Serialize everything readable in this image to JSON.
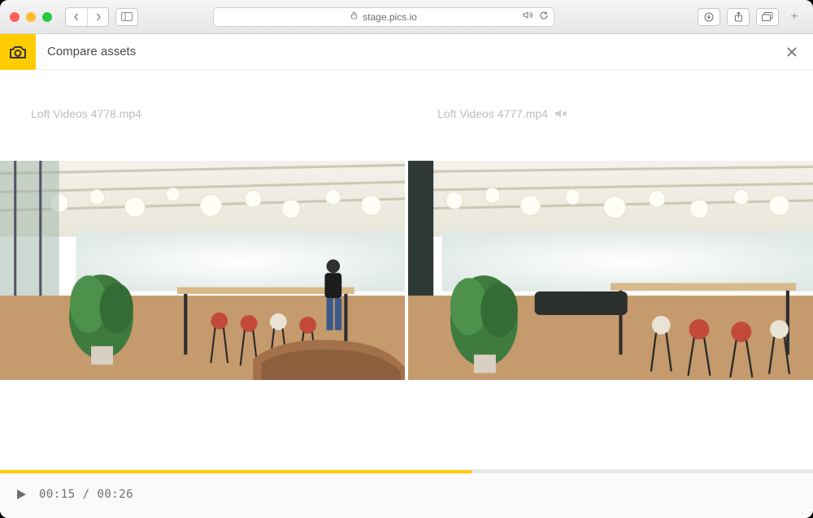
{
  "browser": {
    "url_host": "stage.pics.io"
  },
  "header": {
    "title": "Compare assets"
  },
  "assets": {
    "left": {
      "filename": "Loft Videos 4778.mp4"
    },
    "right": {
      "filename": "Loft Videos 4777.mp4",
      "muted": true
    }
  },
  "player": {
    "current_time": "00:15",
    "duration": "00:26",
    "progress_percent": 58,
    "playing": false
  },
  "colors": {
    "accent": "#ffcc00"
  }
}
